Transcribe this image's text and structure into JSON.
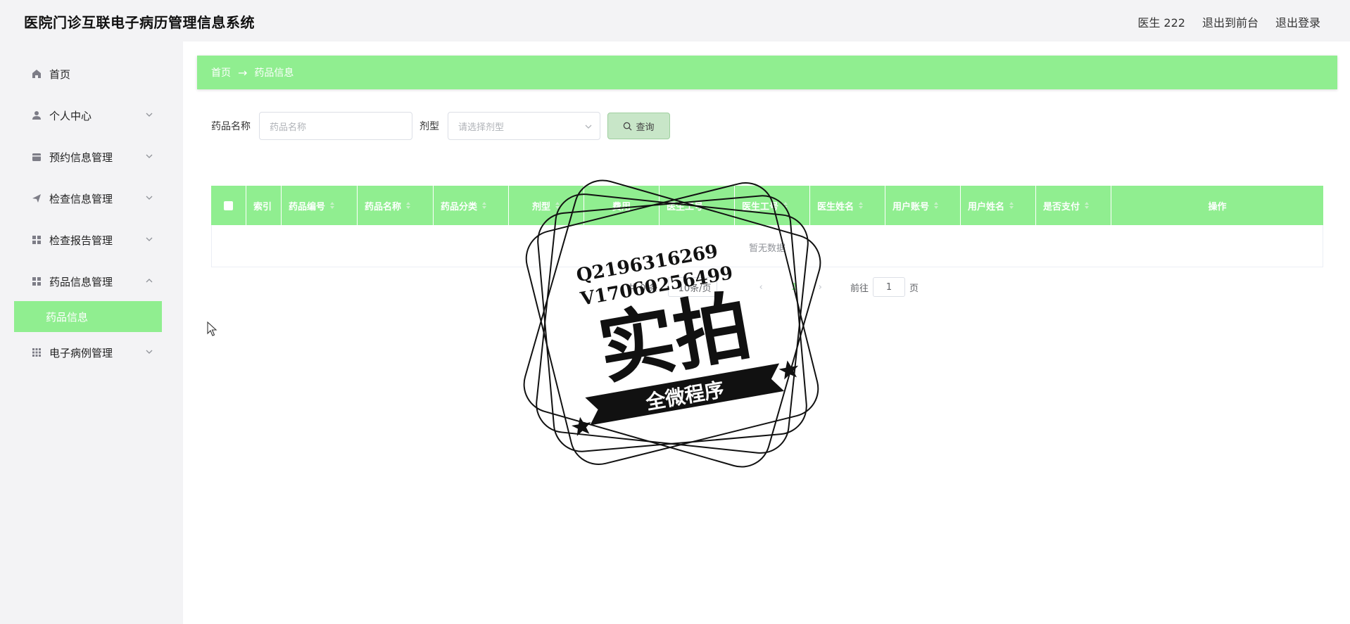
{
  "header": {
    "app_title": "医院门诊互联电子病历管理信息系统",
    "user_label": "医生 222",
    "to_front_label": "退出到前台",
    "logout_label": "退出登录"
  },
  "sidebar": {
    "items": [
      {
        "label": "首页",
        "icon": "home-icon"
      },
      {
        "label": "个人中心",
        "icon": "user-icon"
      },
      {
        "label": "预约信息管理",
        "icon": "calendar-icon"
      },
      {
        "label": "检查信息管理",
        "icon": "send-icon"
      },
      {
        "label": "检查报告管理",
        "icon": "grid-icon"
      },
      {
        "label": "药品信息管理",
        "icon": "grid-icon"
      },
      {
        "label": "药品信息",
        "icon": ""
      },
      {
        "label": "电子病例管理",
        "icon": "apps-icon"
      }
    ]
  },
  "breadcrumb": {
    "home": "首页",
    "current": "药品信息"
  },
  "search": {
    "name_label": "药品名称",
    "name_placeholder": "药品名称",
    "type_label": "剂型",
    "type_placeholder": "请选择剂型",
    "button_label": "查询"
  },
  "table": {
    "columns": [
      "索引",
      "药品编号",
      "药品名称",
      "药品分类",
      "剂型",
      "费用",
      "医生工号",
      "医生工号",
      "医生姓名",
      "用户账号",
      "用户姓名",
      "是否支付",
      "操作"
    ],
    "empty_text": "暂无数据"
  },
  "pagination": {
    "total_text": "共 0 条",
    "page_size": "10条/页",
    "current_page": "1",
    "goto_label": "前往",
    "goto_value": "1",
    "page_suffix": "页"
  },
  "watermark": {
    "line1": "Q2196316269",
    "line2": "V17060256499",
    "main": "实拍",
    "ribbon": "全微程序"
  },
  "colors": {
    "accent": "#90ee90",
    "background": "#f3f3f5"
  }
}
